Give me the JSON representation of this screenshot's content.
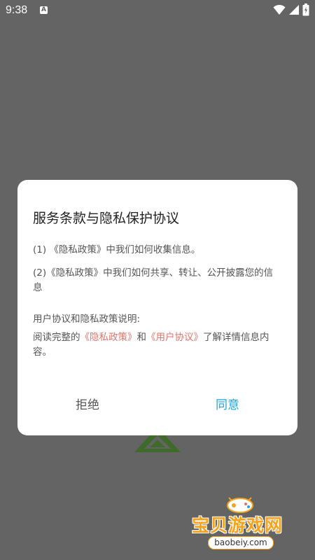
{
  "status_bar": {
    "time": "9:38",
    "notification_icon": "A"
  },
  "dialog": {
    "title": "服务条款与隐私保护协议",
    "items": [
      "(1) 《隐私政策》中我们如何收集信息。",
      "(2)《隐私政策》中我们如何共享、转让、公开披露您的信息"
    ],
    "explanation_heading": "用户协议和隐私政策说明:",
    "read_prefix": "阅读完整的",
    "privacy_link": "《隐私政策》",
    "connector": "和",
    "user_agreement_link": "《用户协议》",
    "read_suffix": "了解详情信息内容。",
    "reject_label": "拒绝",
    "agree_label": "同意"
  },
  "watermark": {
    "title": "宝贝游戏网",
    "url": "baobeiy.com"
  },
  "colors": {
    "overlay": "#646464",
    "link": "#e4726a",
    "agree": "#1fa6d8",
    "watermark": "#f7a21b"
  }
}
